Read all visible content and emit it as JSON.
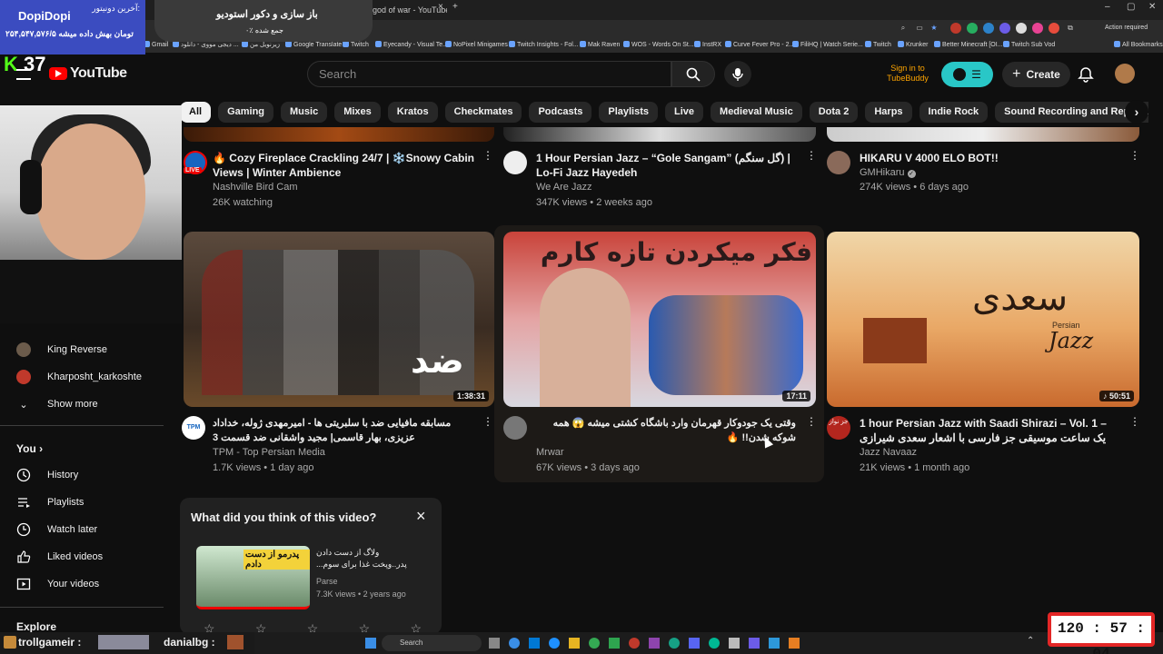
{
  "browser": {
    "tabs": [
      {
        "label": "god of war - YouTube"
      }
    ],
    "action_required": "Action required",
    "bookmarks": [
      "Gmail",
      "دیجی مووی - دانلود ...",
      "زیرنویل من",
      "Google Translate",
      "Twitch",
      "Eyecandy - Visual Te...",
      "NoPixel Minigames",
      "Twitch Insights - Fol...",
      "Mak Raven",
      "WOS - Words On St...",
      "InstRX",
      "Curve Fever Pro - 2...",
      "FiliHQ | Watch Serie...",
      "Twitch",
      "Krunker",
      "Better Minecraft [OI...",
      "Twitch Sub Vod"
    ],
    "all_bookmarks": "All Bookmarks"
  },
  "overlay": {
    "donor_label": "آخرین دونیتور:",
    "donor_name": "DopiDopi",
    "donor_amount": "۲۵۴,۵۴۷,۵۷۶/۵ تومان بهش داده میشه",
    "sponsor_title": "باز سازی و دکور استودیو",
    "sponsor_sub": "۰٪ جمع شده",
    "kick_count": "37",
    "timer": "120 : 57 : 04",
    "chat": [
      {
        "user": "trollgameir :"
      },
      {
        "user": "danialbg :"
      }
    ]
  },
  "header": {
    "logo": "YouTube",
    "search_placeholder": "Search",
    "tubebuddy": "Sign in to TubeBuddy",
    "create": "Create"
  },
  "chips": [
    "All",
    "Gaming",
    "Music",
    "Mixes",
    "Kratos",
    "Checkmates",
    "Podcasts",
    "Playlists",
    "Live",
    "Medieval Music",
    "Dota 2",
    "Harps",
    "Indie Rock",
    "Sound Recording and Reproduction",
    "Bo"
  ],
  "sidebar": {
    "subs": [
      {
        "label": "King Reverse",
        "color": "#6b5b4b"
      },
      {
        "label": "Kharposht_karkoshte",
        "color": "#c0392b"
      }
    ],
    "show_more": "Show more",
    "you_heading": "You",
    "you_items": [
      {
        "label": "History",
        "icon": "history-icon"
      },
      {
        "label": "Playlists",
        "icon": "playlists-icon"
      },
      {
        "label": "Watch later",
        "icon": "watch-later-icon"
      },
      {
        "label": "Liked videos",
        "icon": "like-icon"
      },
      {
        "label": "Your videos",
        "icon": "your-videos-icon"
      }
    ],
    "explore_heading": "Explore"
  },
  "row1": [
    {
      "title": "🔥 Cozy Fireplace Crackling 24/7 | ❄️Snowy Cabin Views | Winter Ambience",
      "channel": "Nashville Bird Cam",
      "meta": "26K watching",
      "live": "LIVE"
    },
    {
      "title": "1 Hour Persian Jazz – “Gole Sangam” (گل سنگم) | Lo-Fi Jazz Hayedeh",
      "channel": "We Are Jazz",
      "meta": "347K views • 2 weeks ago"
    },
    {
      "title": "HIKARU V 4000 ELO BOT!!",
      "channel": "GMHikaru",
      "meta": "274K views • 6 days ago",
      "verified": true
    }
  ],
  "row2": [
    {
      "title": "مسابقه مافیایی ضد با سلبریتی ها - امیرمهدی ژوله، خداداد عزیزی، بهار قاسمی| مجید واشقانی ضد قسمت 3",
      "channel": "TPM - Top Persian Media",
      "meta": "1.7K views • 1 day ago",
      "duration": "1:38:31",
      "thumb_text": "ضد",
      "av": "TPM"
    },
    {
      "title": "وقتی یک جودوکار قهرمان وارد باشگاه کشتی میشه 😱 همه شوکه شدن!! 🔥",
      "channel": "Mrwar",
      "meta": "67K views • 3 days ago",
      "duration": "17:11",
      "thumb_text": "فکر میکردن تازه کارم"
    },
    {
      "title": "1 hour Persian Jazz with Saadi Shirazi – Vol. 1 – یک ساعت موسیقی جز فارسی با اشعار سعدی شیرازی",
      "channel": "Jazz Navaaz",
      "meta": "21K views • 1 month ago",
      "duration": "50:51",
      "thumb_text": "سعدی",
      "thumb_sub": "Persian",
      "thumb_jazz": "Jazz",
      "av": "جز نواز"
    }
  ],
  "survey": {
    "title": "What did you think of this video?",
    "video_title": "ولاگ از دست دادن پدر..وپخت غذا برای سوم...",
    "channel": "Parse",
    "meta": "7.3K views • 2 years ago",
    "thumb_text": "پدرمو از دست دادم"
  },
  "taskbar": {
    "search": "Search"
  }
}
